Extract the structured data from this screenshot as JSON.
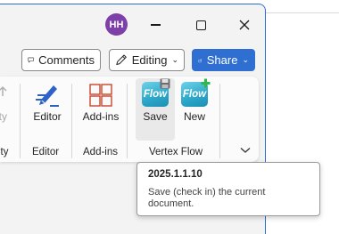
{
  "titlebar": {
    "avatar_initials": "HH"
  },
  "commandbar": {
    "comments_label": "Comments",
    "editing_label": "Editing",
    "share_label": "Share"
  },
  "ribbon": {
    "buttons": [
      {
        "label": "ity"
      },
      {
        "label": "Editor"
      },
      {
        "label": "Add-ins"
      },
      {
        "label": "Save",
        "icon_text": "Flow"
      },
      {
        "label": "New",
        "icon_text": "Flow"
      }
    ],
    "groups": [
      {
        "label": "ity"
      },
      {
        "label": "Editor"
      },
      {
        "label": "Add-ins"
      },
      {
        "label": "Vertex Flow"
      }
    ]
  },
  "tooltip": {
    "title": "2025.1.1.10",
    "description": "Save (check in) the current document."
  },
  "colors": {
    "accent": "#2f6fd1",
    "avatar": "#7d3fa8",
    "flow_icon": "#2ba6c9",
    "new_badge": "#2eb84b"
  }
}
